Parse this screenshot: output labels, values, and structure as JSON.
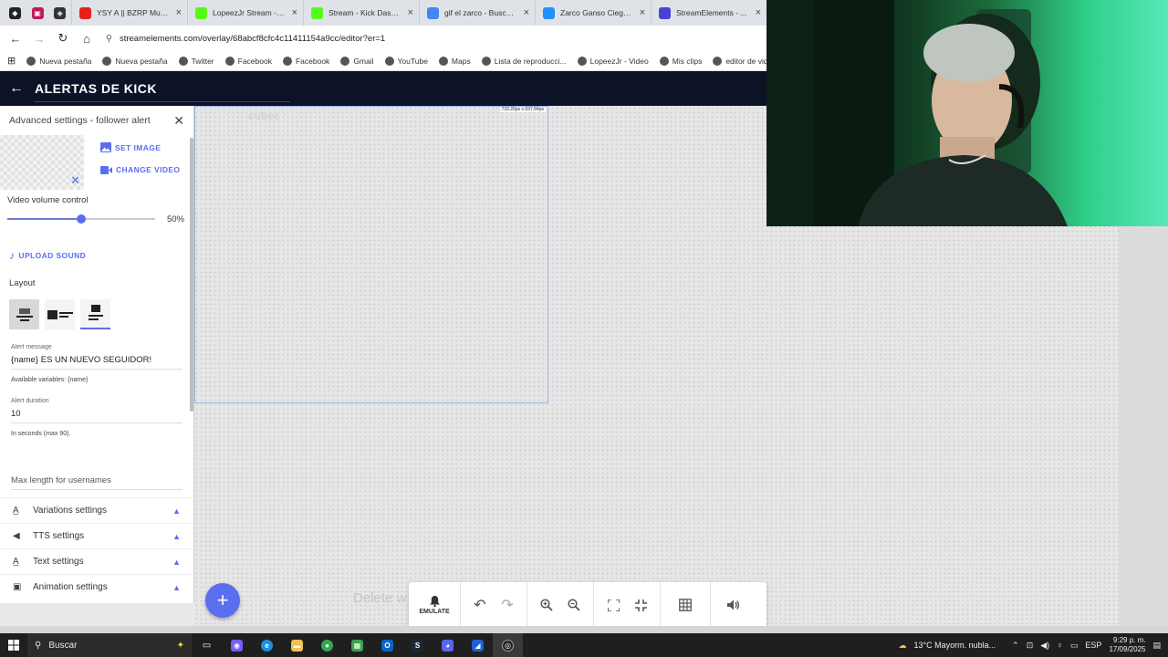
{
  "browser": {
    "tabs": [
      {
        "title": "YSY A || BZRP Music Se...",
        "icon": "youtube-icon",
        "color": "#e62117"
      },
      {
        "title": "LopeezJr Stream - Wat...",
        "icon": "kick-icon",
        "color": "#53fc18"
      },
      {
        "title": "Stream - Kick Dashboar...",
        "icon": "kick-icon",
        "color": "#53fc18"
      },
      {
        "title": "gif el zarco - Buscar co...",
        "icon": "google-icon",
        "color": "#4285f4"
      },
      {
        "title": "Zarco Ganso Ciego GIF",
        "icon": "gif-icon",
        "color": "#1e90ff"
      },
      {
        "title": "StreamElements - ...",
        "icon": "streamelements-icon",
        "color": "#4b3fd8"
      }
    ],
    "url": "streamelements.com/overlay/68abcf8cfc4c11411154a9cc/editor?er=1",
    "bookmarks": [
      {
        "label": "Nueva pestaña",
        "icon": "chrome-tab-icon"
      },
      {
        "label": "Nueva pestaña",
        "icon": "chrome-tab-icon"
      },
      {
        "label": "Twitter",
        "icon": "x-icon"
      },
      {
        "label": "Facebook",
        "icon": "facebook-icon"
      },
      {
        "label": "Facebook",
        "icon": "facebook-icon"
      },
      {
        "label": "Gmail",
        "icon": "gmail-icon"
      },
      {
        "label": "YouTube",
        "icon": "youtube-icon"
      },
      {
        "label": "Maps",
        "icon": "maps-icon"
      },
      {
        "label": "Lista de reproducci...",
        "icon": "tiktok-icon"
      },
      {
        "label": "LopeezJr - Video",
        "icon": "web-icon"
      },
      {
        "label": "Mis clips",
        "icon": "clips-icon"
      },
      {
        "label": "editor de videos onli...",
        "icon": "editor-icon"
      }
    ]
  },
  "app": {
    "title": "ALERTAS DE KICK"
  },
  "panel": {
    "title": "Advanced settings - follower alert",
    "set_image": "SET IMAGE",
    "change_video": "CHANGE VIDEO",
    "video_volume_label": "Video volume control",
    "video_volume_value": "50%",
    "video_volume_fraction": 0.5,
    "upload_sound": "UPLOAD SOUND",
    "layout_label": "Layout",
    "alert_message_label": "Alert message",
    "alert_message_value": "{name} ES UN NUEVO SEGUIDOR!",
    "alert_message_help": "Available variables: {name}",
    "alert_duration_label": "Alert duration",
    "alert_duration_value": "10",
    "alert_duration_help": "In seconds (max 90).",
    "max_length_placeholder": "Max length for usernames",
    "accordions": [
      {
        "label": "Variations settings",
        "icon": "variations-icon"
      },
      {
        "label": "TTS settings",
        "icon": "speaker-icon"
      },
      {
        "label": "Text settings",
        "icon": "text-icon"
      },
      {
        "label": "Animation settings",
        "icon": "clapper-icon"
      }
    ]
  },
  "canvas": {
    "dims": "733.20px x 697.84px",
    "ghost_name": "cubes",
    "ghost_text": "Delete w"
  },
  "toolbar": {
    "emulate": "EMULATE"
  },
  "taskbar": {
    "search": "Buscar",
    "weather": "13°C  Mayorm. nubla...",
    "lang": "ESP",
    "time": "9:29 p. m.",
    "date": "17/09/2025"
  },
  "colors": {
    "accent": "#5a6ef0",
    "header": "#0d1326"
  }
}
